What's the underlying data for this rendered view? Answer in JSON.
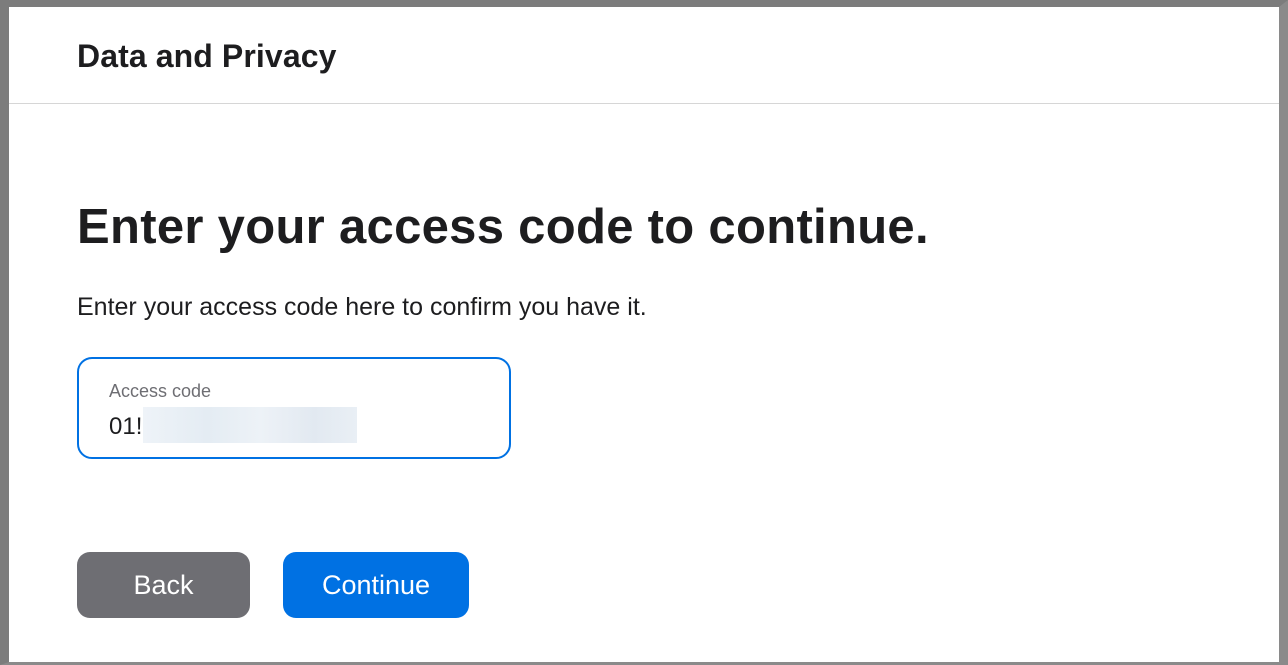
{
  "header": {
    "title": "Data and Privacy"
  },
  "main": {
    "heading": "Enter your access code to continue.",
    "description": "Enter your access code here to confirm you have it."
  },
  "access_code_field": {
    "label": "Access code",
    "value": "01!",
    "redacted": true
  },
  "buttons": {
    "back_label": "Back",
    "continue_label": "Continue"
  },
  "colors": {
    "accent": "#0071e3",
    "secondary_button": "#6e6e73",
    "text": "#1d1d1f"
  }
}
